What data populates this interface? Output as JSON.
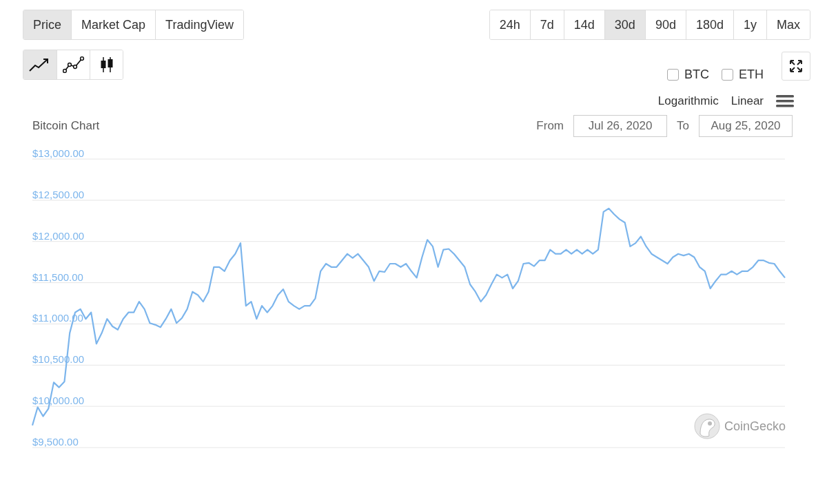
{
  "view_tabs": [
    {
      "label": "Price",
      "selected": true
    },
    {
      "label": "Market Cap",
      "selected": false
    },
    {
      "label": "TradingView",
      "selected": false
    }
  ],
  "periods": [
    {
      "label": "24h",
      "selected": false
    },
    {
      "label": "7d",
      "selected": false
    },
    {
      "label": "14d",
      "selected": false
    },
    {
      "label": "30d",
      "selected": true
    },
    {
      "label": "90d",
      "selected": false
    },
    {
      "label": "180d",
      "selected": false
    },
    {
      "label": "1y",
      "selected": false
    },
    {
      "label": "Max",
      "selected": false
    }
  ],
  "chart_types": [
    {
      "kind": "line",
      "selected": true
    },
    {
      "kind": "points",
      "selected": false
    },
    {
      "kind": "candles",
      "selected": false
    }
  ],
  "compare": [
    {
      "label": "BTC",
      "checked": false
    },
    {
      "label": "ETH",
      "checked": false
    }
  ],
  "scales": [
    {
      "label": "Logarithmic"
    },
    {
      "label": "Linear"
    }
  ],
  "chart_title": "Bitcoin Chart",
  "range": {
    "from_label": "From",
    "from": "Jul 26, 2020",
    "to_label": "To",
    "to": "Aug 25, 2020"
  },
  "chart": {
    "chart_data": {
      "type": "line",
      "grid": true,
      "ylim": [
        9500,
        13000
      ],
      "yticks": [
        {
          "value": 13000,
          "label": "$13,000.00"
        },
        {
          "value": 12500,
          "label": "$12,500.00"
        },
        {
          "value": 12000,
          "label": "$12,000.00"
        },
        {
          "value": 11500,
          "label": "$11,500.00"
        },
        {
          "value": 11000,
          "label": "$11,000.00"
        },
        {
          "value": 10500,
          "label": "$10,500.00"
        },
        {
          "value": 10000,
          "label": "$10,000.00"
        },
        {
          "value": 9500,
          "label": "$9,500.00"
        }
      ],
      "series": [
        {
          "color": "#7cb5ec",
          "values": [
            9770,
            9990,
            9880,
            9970,
            10290,
            10230,
            10300,
            10890,
            11140,
            11180,
            11060,
            11140,
            10760,
            10890,
            11060,
            10970,
            10930,
            11060,
            11140,
            11140,
            11270,
            11180,
            11010,
            10990,
            10960,
            11060,
            11180,
            11010,
            11070,
            11180,
            11390,
            11350,
            11270,
            11390,
            11690,
            11690,
            11640,
            11770,
            11850,
            11980,
            11220,
            11270,
            11060,
            11220,
            11140,
            11220,
            11350,
            11420,
            11270,
            11220,
            11180,
            11220,
            11220,
            11310,
            11640,
            11730,
            11690,
            11690,
            11770,
            11850,
            11800,
            11850,
            11770,
            11690,
            11520,
            11640,
            11630,
            11730,
            11730,
            11690,
            11730,
            11640,
            11560,
            11810,
            12020,
            11940,
            11690,
            11900,
            11910,
            11850,
            11770,
            11690,
            11480,
            11390,
            11270,
            11350,
            11480,
            11600,
            11560,
            11600,
            11430,
            11520,
            11730,
            11740,
            11700,
            11770,
            11770,
            11900,
            11850,
            11850,
            11900,
            11850,
            11900,
            11850,
            11900,
            11850,
            11900,
            12360,
            12400,
            12330,
            12270,
            12230,
            11940,
            11980,
            12060,
            11940,
            11850,
            11810,
            11770,
            11730,
            11810,
            11850,
            11830,
            11850,
            11810,
            11690,
            11640,
            11430,
            11520,
            11600,
            11600,
            11640,
            11600,
            11640,
            11640,
            11690,
            11770,
            11770,
            11740,
            11730,
            11640,
            11560
          ]
        }
      ]
    }
  },
  "credit": "CoinGecko"
}
